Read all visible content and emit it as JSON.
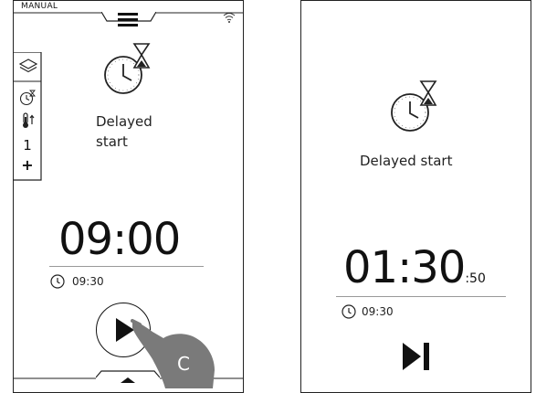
{
  "left_screen": {
    "mode_label": "MANUAL",
    "side_panel": {
      "level_value": "1",
      "plus_label": "+"
    },
    "program_label_line1": "Delayed",
    "program_label_line2": "start",
    "start_time": "09:00",
    "end_time": "09:30",
    "hand_letter": "C"
  },
  "right_screen": {
    "program_label": "Delayed start",
    "remaining_main": "01:30",
    "remaining_seconds": ":50",
    "end_time": "09:30"
  },
  "colors": {
    "ink": "#111111",
    "hand": "#7a7a7a"
  },
  "icons": [
    "menu-icon",
    "wifi-icon",
    "layers-icon",
    "delayed-start-icon",
    "thermometer-icon",
    "clock-icon",
    "play-icon",
    "chevron-up-icon",
    "skip-icon"
  ]
}
